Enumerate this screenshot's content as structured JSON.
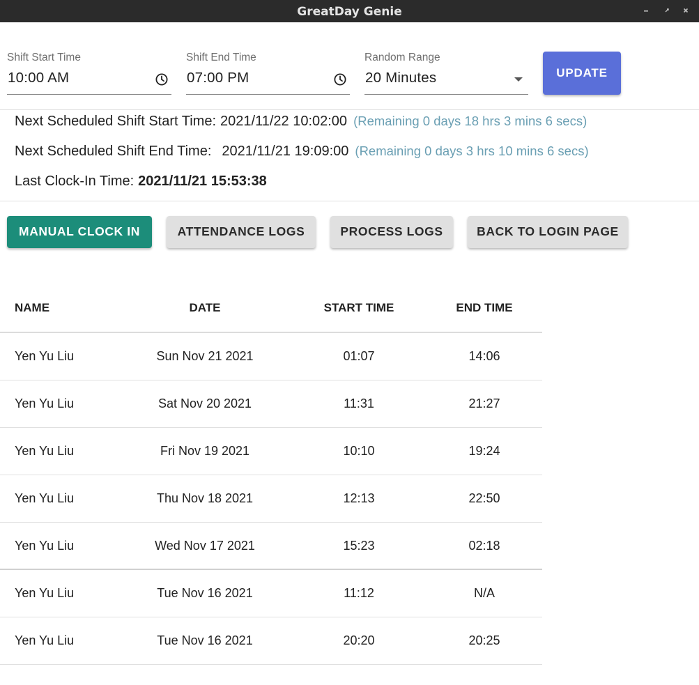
{
  "window": {
    "title": "GreatDay Genie"
  },
  "settings": {
    "shift_start": {
      "label": "Shift Start Time",
      "value": "10:00 AM"
    },
    "shift_end": {
      "label": "Shift End Time",
      "value": "07:00 PM"
    },
    "random_range": {
      "label": "Random Range",
      "value": "20 Minutes"
    },
    "update_label": "UPDATE"
  },
  "schedule": {
    "next_start": {
      "label": "Next Scheduled Shift Start Time:",
      "value": "2021/11/22 10:02:00",
      "remaining": "(Remaining 0 days 18 hrs 3 mins 6 secs)"
    },
    "next_end": {
      "label": "Next Scheduled Shift End Time:",
      "value": "2021/11/21 19:09:00",
      "remaining": "(Remaining 0 days 3 hrs 10 mins 6 secs)"
    },
    "last_clock_in": {
      "label": "Last Clock-In Time:",
      "value": "2021/11/21 15:53:38"
    }
  },
  "actions": {
    "manual_clock_in": "MANUAL CLOCK IN",
    "attendance_logs": "ATTENDANCE LOGS",
    "process_logs": "PROCESS LOGS",
    "back_to_login": "BACK TO LOGIN PAGE"
  },
  "table": {
    "columns": [
      "NAME",
      "DATE",
      "START TIME",
      "END TIME"
    ],
    "rows": [
      {
        "name": "Yen Yu Liu",
        "date": "Sun Nov 21 2021",
        "start": "01:07",
        "end": "14:06"
      },
      {
        "name": "Yen Yu Liu",
        "date": "Sat Nov 20 2021",
        "start": "11:31",
        "end": "21:27"
      },
      {
        "name": "Yen Yu Liu",
        "date": "Fri Nov 19 2021",
        "start": "10:10",
        "end": "19:24"
      },
      {
        "name": "Yen Yu Liu",
        "date": "Thu Nov 18 2021",
        "start": "12:13",
        "end": "22:50"
      },
      {
        "name": "Yen Yu Liu",
        "date": "Wed Nov 17 2021",
        "start": "15:23",
        "end": "02:18"
      },
      {
        "name": "Yen Yu Liu",
        "date": "Tue Nov 16 2021",
        "start": "11:12",
        "end": "N/A"
      },
      {
        "name": "Yen Yu Liu",
        "date": "Tue Nov 16 2021",
        "start": "20:20",
        "end": "20:25"
      }
    ]
  },
  "colors": {
    "update_button": "#5a6fd9",
    "clock_in_button": "#1c8d7a",
    "remaining_text": "#6a9fb3",
    "titlebar": "#2b2b2b"
  },
  "icons": {
    "clock": "clock-icon",
    "dropdown": "caret-down-icon",
    "minimize": "minimize-icon",
    "maximize": "maximize-icon",
    "close": "close-icon"
  }
}
